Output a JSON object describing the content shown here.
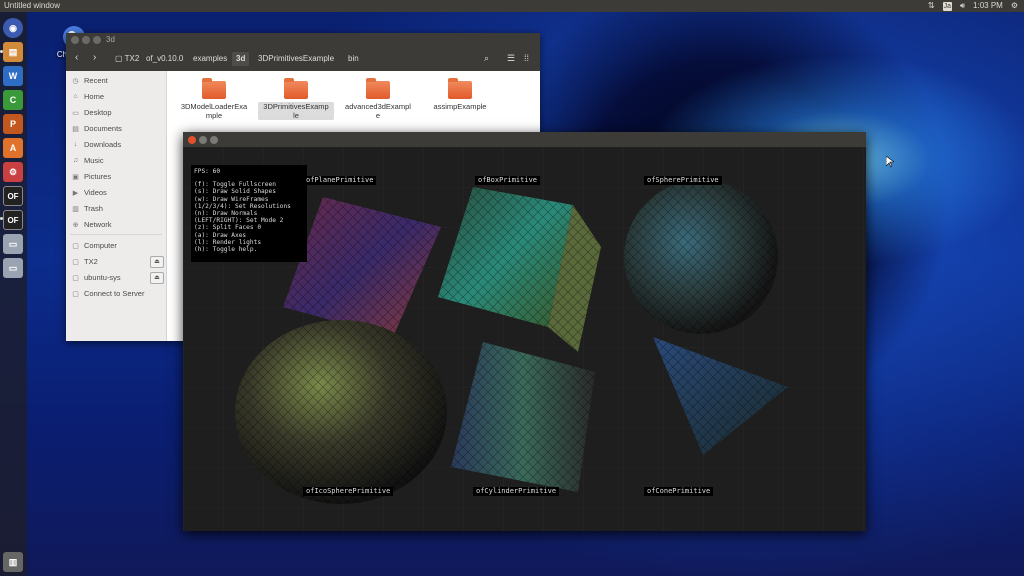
{
  "top_panel": {
    "title": "Untitled window",
    "time": "1:03 PM",
    "keyboard": "Ja"
  },
  "desktop_icon": {
    "label": "Chrom Br"
  },
  "launcher": {
    "items": [
      {
        "name": "dash",
        "glyph": "◉",
        "color": "#3b5bb0"
      },
      {
        "name": "files",
        "glyph": "▤",
        "color": "#d28b3b"
      },
      {
        "name": "writer",
        "glyph": "W",
        "color": "#2f6cc4"
      },
      {
        "name": "calc",
        "glyph": "C",
        "color": "#3a9a3a"
      },
      {
        "name": "impress",
        "glyph": "P",
        "color": "#c2571f"
      },
      {
        "name": "software",
        "glyph": "A",
        "color": "#e0732c"
      },
      {
        "name": "settings",
        "glyph": "⚙",
        "color": "#c94040"
      },
      {
        "name": "of1",
        "glyph": "OF",
        "color": "#222222"
      },
      {
        "name": "of2",
        "glyph": "OF",
        "color": "#222222"
      },
      {
        "name": "drive1",
        "glyph": "▭",
        "color": "#9aa3b2"
      },
      {
        "name": "drive2",
        "glyph": "▭",
        "color": "#9aa3b2"
      },
      {
        "name": "trash",
        "glyph": "🗑",
        "color": "#777777"
      }
    ]
  },
  "file_manager": {
    "title": "3d",
    "breadcrumbs": [
      "TX2",
      "of_v0.10.0",
      "examples",
      "3d",
      "3DPrimitivesExample",
      "bin"
    ],
    "active_crumb": "3d",
    "sidebar": [
      {
        "label": "Recent",
        "icon": "◷"
      },
      {
        "label": "Home",
        "icon": "⌂"
      },
      {
        "label": "Desktop",
        "icon": "▭"
      },
      {
        "label": "Documents",
        "icon": "▤"
      },
      {
        "label": "Downloads",
        "icon": "↓"
      },
      {
        "label": "Music",
        "icon": "♫"
      },
      {
        "label": "Pictures",
        "icon": "▣"
      },
      {
        "label": "Videos",
        "icon": "▶"
      },
      {
        "label": "Trash",
        "icon": "▥"
      },
      {
        "label": "Network",
        "icon": "⊕"
      },
      {
        "label": "Computer",
        "icon": "▢"
      },
      {
        "label": "TX2",
        "icon": "▢"
      },
      {
        "label": "ubuntu-sys",
        "icon": "▢"
      },
      {
        "label": "Connect to Server",
        "icon": "▢"
      }
    ],
    "folders": [
      {
        "line1": "3DModelLoaderExa",
        "line2": "mple"
      },
      {
        "line1": "3DPrimitivesExamp",
        "line2": "le"
      },
      {
        "line1": "advanced3dExampl",
        "line2": "e"
      },
      {
        "line1": "assimpExample",
        "line2": ""
      }
    ]
  },
  "of_window": {
    "help_lines": [
      "FPS: 60",
      "(f): Toggle Fullscreen",
      "(s): Draw Solid Shapes",
      "(w): Draw WireFrames",
      "(1/2/3/4): Set Resolutions",
      "(n): Draw Normals",
      "(LEFT/RIGHT): Set Mode 2",
      "(z): Split Faces 0",
      "(a): Draw Axes",
      "(l): Render lights",
      "(h): Toggle help."
    ],
    "labels": [
      "ofPlanePrimitive",
      "ofBoxPrimitive",
      "ofSpherePrimitive",
      "ofIcoSpherePrimitive",
      "ofCylinderPrimitive",
      "ofConePrimitive"
    ]
  }
}
